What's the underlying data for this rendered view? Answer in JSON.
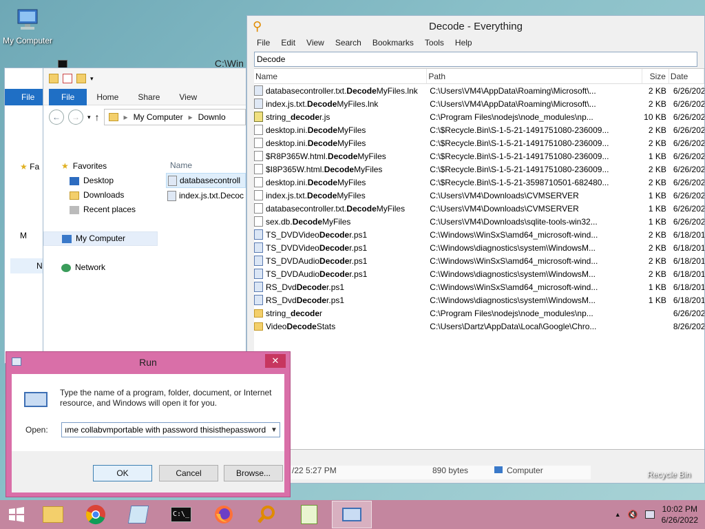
{
  "desktop": {
    "my_computer_label": "My Computer",
    "recycle_bin_label": "Recycle Bin"
  },
  "cmd_window": {
    "title": "C:\\Win"
  },
  "explorer_back": {
    "file_tab": "File",
    "nav": [
      "Fa",
      "M",
      "N"
    ]
  },
  "explorer": {
    "tabs": {
      "file": "File",
      "home": "Home",
      "share": "Share",
      "view": "View"
    },
    "address": {
      "crumb1": "My Computer",
      "crumb2": "Downlo"
    },
    "nav": {
      "favorites": "Favorites",
      "desktop": "Desktop",
      "downloads": "Downloads",
      "recent": "Recent places",
      "my_computer": "My Computer",
      "network": "Network"
    },
    "list_header": "Name",
    "files": [
      "databasecontroll",
      "index.js.txt.Decoc"
    ],
    "status": {
      "date": "/22 5:27 PM",
      "size": "890 bytes",
      "location": "Computer"
    }
  },
  "everything": {
    "title": "Decode - Everything",
    "menu": [
      "File",
      "Edit",
      "View",
      "Search",
      "Bookmarks",
      "Tools",
      "Help"
    ],
    "search_value": "Decode",
    "columns": {
      "name": "Name",
      "path": "Path",
      "size": "Size",
      "date": "Date Mod"
    },
    "rows": [
      {
        "icon": "lnk",
        "pre": "databasecontroller.txt.",
        "match": "Decode",
        "post": "MyFiles.lnk",
        "path": "C:\\Users\\VM4\\AppData\\Roaming\\Microsoft\\...",
        "size": "2 KB",
        "date": "6/26/202"
      },
      {
        "icon": "lnk",
        "pre": "index.js.txt.",
        "match": "Decode",
        "post": "MyFiles.lnk",
        "path": "C:\\Users\\VM4\\AppData\\Roaming\\Microsoft\\...",
        "size": "2 KB",
        "date": "6/26/202"
      },
      {
        "icon": "js",
        "pre": "string_",
        "match": "decode",
        "post": "r.js",
        "path": "C:\\Program Files\\nodejs\\node_modules\\np...",
        "size": "10 KB",
        "date": "6/26/202"
      },
      {
        "icon": "file",
        "pre": "desktop.ini.",
        "match": "Decode",
        "post": "MyFiles",
        "path": "C:\\$Recycle.Bin\\S-1-5-21-1491751080-236009...",
        "size": "2 KB",
        "date": "6/26/202"
      },
      {
        "icon": "file",
        "pre": "desktop.ini.",
        "match": "Decode",
        "post": "MyFiles",
        "path": "C:\\$Recycle.Bin\\S-1-5-21-1491751080-236009...",
        "size": "2 KB",
        "date": "6/26/202"
      },
      {
        "icon": "file",
        "pre": "$R8P365W.html.",
        "match": "Decode",
        "post": "MyFiles",
        "path": "C:\\$Recycle.Bin\\S-1-5-21-1491751080-236009...",
        "size": "1 KB",
        "date": "6/26/202"
      },
      {
        "icon": "file",
        "pre": "$I8P365W.html.",
        "match": "Decode",
        "post": "MyFiles",
        "path": "C:\\$Recycle.Bin\\S-1-5-21-1491751080-236009...",
        "size": "2 KB",
        "date": "6/26/202"
      },
      {
        "icon": "file",
        "pre": "desktop.ini.",
        "match": "Decode",
        "post": "MyFiles",
        "path": "C:\\$Recycle.Bin\\S-1-5-21-3598710501-682480...",
        "size": "2 KB",
        "date": "6/26/202"
      },
      {
        "icon": "file",
        "pre": "index.js.txt.",
        "match": "Decode",
        "post": "MyFiles",
        "path": "C:\\Users\\VM4\\Downloads\\CVMSERVER",
        "size": "1 KB",
        "date": "6/26/202"
      },
      {
        "icon": "file",
        "pre": "databasecontroller.txt.",
        "match": "Decode",
        "post": "MyFiles",
        "path": "C:\\Users\\VM4\\Downloads\\CVMSERVER",
        "size": "1 KB",
        "date": "6/26/202"
      },
      {
        "icon": "file",
        "pre": "sex.db.",
        "match": "Decode",
        "post": "MyFiles",
        "path": "C:\\Users\\VM4\\Downloads\\sqlite-tools-win32...",
        "size": "1 KB",
        "date": "6/26/202"
      },
      {
        "icon": "ps",
        "pre": "TS_DVDVideo",
        "match": "Decode",
        "post": "r.ps1",
        "path": "C:\\Windows\\WinSxS\\amd64_microsoft-wind...",
        "size": "2 KB",
        "date": "6/18/201"
      },
      {
        "icon": "ps",
        "pre": "TS_DVDVideo",
        "match": "Decode",
        "post": "r.ps1",
        "path": "C:\\Windows\\diagnostics\\system\\WindowsM...",
        "size": "2 KB",
        "date": "6/18/201"
      },
      {
        "icon": "ps",
        "pre": "TS_DVDAudio",
        "match": "Decode",
        "post": "r.ps1",
        "path": "C:\\Windows\\WinSxS\\amd64_microsoft-wind...",
        "size": "2 KB",
        "date": "6/18/201"
      },
      {
        "icon": "ps",
        "pre": "TS_DVDAudio",
        "match": "Decode",
        "post": "r.ps1",
        "path": "C:\\Windows\\diagnostics\\system\\WindowsM...",
        "size": "2 KB",
        "date": "6/18/201"
      },
      {
        "icon": "ps",
        "pre": "RS_Dvd",
        "match": "Decode",
        "post": "r.ps1",
        "path": "C:\\Windows\\WinSxS\\amd64_microsoft-wind...",
        "size": "1 KB",
        "date": "6/18/201"
      },
      {
        "icon": "ps",
        "pre": "RS_Dvd",
        "match": "Decode",
        "post": "r.ps1",
        "path": "C:\\Windows\\diagnostics\\system\\WindowsM...",
        "size": "1 KB",
        "date": "6/18/201"
      },
      {
        "icon": "folder",
        "pre": "string_",
        "match": "decode",
        "post": "r",
        "path": "C:\\Program Files\\nodejs\\node_modules\\np...",
        "size": "",
        "date": "6/26/202"
      },
      {
        "icon": "folder",
        "pre": "Video",
        "match": "Decode",
        "post": "Stats",
        "path": "C:\\Users\\Dartz\\AppData\\Local\\Google\\Chro...",
        "size": "",
        "date": "8/26/202"
      }
    ]
  },
  "run": {
    "title": "Run",
    "close": "✕",
    "description": "Type the name of a program, folder, document, or Internet resource, and Windows will open it for you.",
    "open_label": "Open:",
    "open_value": "ıme collabvmportable with password thisisthepassword",
    "ok": "OK",
    "cancel": "Cancel",
    "browse": "Browse..."
  },
  "taskbar": {
    "clock_time": "10:02 PM",
    "clock_date": "6/26/2022",
    "items": [
      "start-icon",
      "file-explorer-icon",
      "chrome-icon",
      "notepad-icon",
      "cmd-icon",
      "firefox-icon",
      "everything-search-icon",
      "notepadpp-icon",
      "run-icon"
    ]
  },
  "colors": {
    "taskbar": "#c4869f",
    "run_frame": "#d96fa8",
    "ribbon_file": "#1f6fc5",
    "close_button": "#c7365f"
  }
}
